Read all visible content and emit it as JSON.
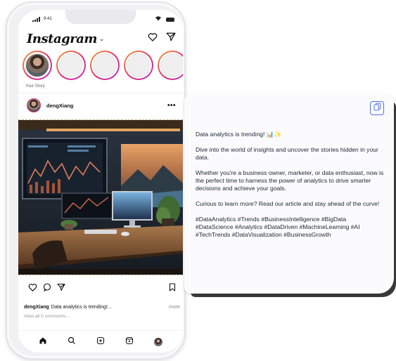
{
  "status_bar": {
    "time": "9:41"
  },
  "instagram": {
    "logo": "Instagram",
    "caret": "⌄",
    "your_story_label": "Your Story",
    "post_username": "dengXiang",
    "more_dots": "•••",
    "caption_user": "dengXiang",
    "caption_text": "Data analytics is trending!...",
    "caption_more": "more",
    "comments_link": "View all 0 comments..."
  },
  "caption_card": {
    "paragraphs": [
      "Data analytics is trending! 📊✨",
      "Dive into the world of insights and uncover the stories hidden in your data.",
      "Whether you're a business owner, marketer, or data enthusiast, now is the perfect time to harness the power of analytics to drive smarter decisions and achieve your goals.",
      "Curious to learn more? Read our article and stay ahead of the curve!",
      "#DataAnalytics #Trends #BusinessIntelligence #BigData #DataScience #Analytics #DataDriven #MachineLearning #AI #TechTrends #DataVisualization #BusinessGrowth"
    ]
  },
  "icons": {
    "header": [
      "heart-icon",
      "send-icon"
    ],
    "post_actions": [
      "heart-icon",
      "comment-icon",
      "share-icon",
      "bookmark-icon"
    ],
    "tabbar": [
      "home-icon",
      "search-icon",
      "add-post-icon",
      "reels-icon",
      "profile-avatar"
    ],
    "card": [
      "copy-icon"
    ]
  },
  "colors": {
    "story_ring_start": "#f9a13a",
    "story_ring_mid": "#e1306c",
    "story_ring_end": "#b92fd1",
    "copy_button_accent": "#4f6ee8",
    "card_text": "#1d2733"
  }
}
